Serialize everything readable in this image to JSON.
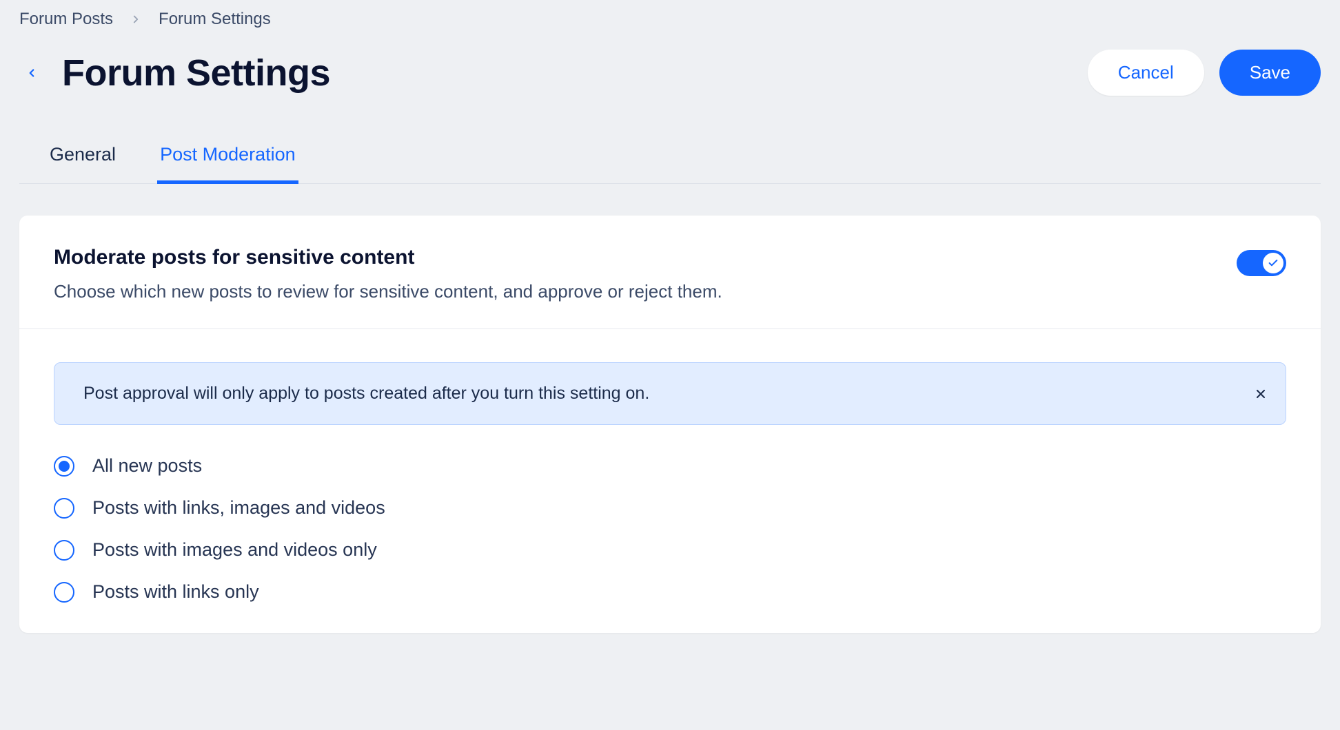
{
  "breadcrumb": {
    "items": [
      {
        "label": "Forum Posts"
      },
      {
        "label": "Forum Settings"
      }
    ]
  },
  "header": {
    "title": "Forum Settings",
    "cancel_label": "Cancel",
    "save_label": "Save"
  },
  "tabs": [
    {
      "label": "General",
      "active": false
    },
    {
      "label": "Post Moderation",
      "active": true
    }
  ],
  "moderation": {
    "title": "Moderate posts for sensitive content",
    "description": "Choose which new posts to review for sensitive content, and approve or reject them.",
    "enabled": true,
    "alert": "Post approval will only apply to posts created after you turn this setting on.",
    "options": [
      {
        "label": "All new posts",
        "selected": true
      },
      {
        "label": "Posts with links, images and videos",
        "selected": false
      },
      {
        "label": "Posts with images and videos only",
        "selected": false
      },
      {
        "label": "Posts with links only",
        "selected": false
      }
    ]
  },
  "colors": {
    "accent": "#1566ff",
    "bg": "#eef0f3"
  }
}
